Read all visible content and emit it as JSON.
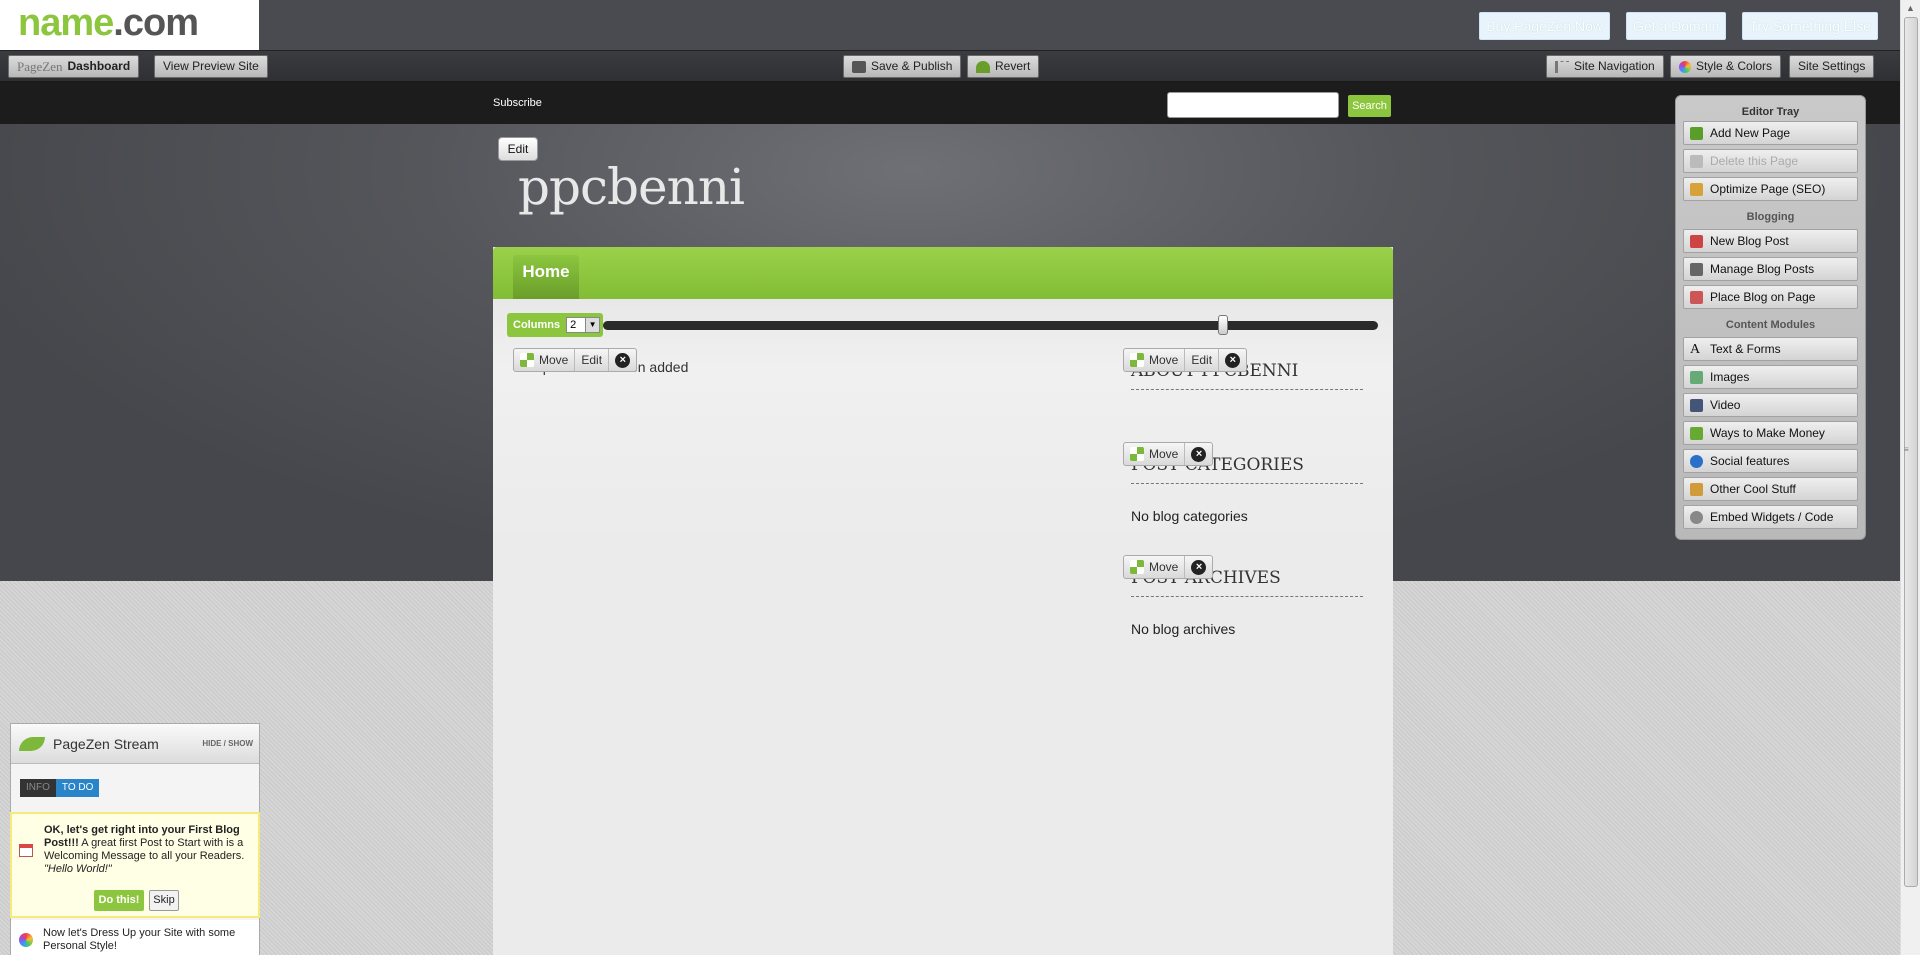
{
  "brand": {
    "logo_main": "name",
    "logo_dot": ".",
    "logo_com": "com"
  },
  "promo": [
    {
      "label": "Buy PageZen Now"
    },
    {
      "label": "Get a Domain"
    },
    {
      "label": "Try Something Else"
    }
  ],
  "toolbar": {
    "pagezen_logo": "PageZen",
    "dashboard": "Dashboard",
    "preview": "View Preview Site",
    "save_publish": "Save & Publish",
    "revert": "Revert",
    "site_navigation": "Site Navigation",
    "style_colors": "Style & Colors",
    "site_settings": "Site Settings"
  },
  "site_nav": {
    "subscribe": "Subscribe",
    "search_button": "Search",
    "search_placeholder": ""
  },
  "header": {
    "edit": "Edit",
    "site_title": "ppcbenni"
  },
  "menu": {
    "home": "Home"
  },
  "columns": {
    "label": "Columns",
    "value": "2",
    "slider_fraction": 0.8
  },
  "widget_controls": {
    "move": "Move",
    "edit": "Edit"
  },
  "main": {
    "empty_text": "No posts have been added"
  },
  "sidebar": [
    {
      "heading": "ABOUT PPCBENNI",
      "text": ""
    },
    {
      "heading": "POST CATEGORIES",
      "text": "No blog categories"
    },
    {
      "heading": "POST ARCHIVES",
      "text": "No blog archives"
    }
  ],
  "tray": {
    "title": "Editor Tray",
    "pages": [
      {
        "label": "Add New Page",
        "icon": "add-page-icon",
        "disabled": false
      },
      {
        "label": "Delete this Page",
        "icon": "delete-page-icon",
        "disabled": true
      },
      {
        "label": "Optimize Page (SEO)",
        "icon": "seo-icon",
        "disabled": false
      }
    ],
    "blogging_title": "Blogging",
    "blogging": [
      {
        "label": "New Blog Post",
        "icon": "new-post-icon"
      },
      {
        "label": "Manage Blog Posts",
        "icon": "calendar-icon"
      },
      {
        "label": "Place Blog on Page",
        "icon": "place-blog-icon"
      }
    ],
    "modules_title": "Content Modules",
    "modules": [
      {
        "label": "Text & Forms",
        "icon": "text-icon"
      },
      {
        "label": "Images",
        "icon": "image-icon"
      },
      {
        "label": "Video",
        "icon": "video-icon"
      },
      {
        "label": "Ways to Make Money",
        "icon": "dollar-icon"
      },
      {
        "label": "Social features",
        "icon": "speech-bubble-icon"
      },
      {
        "label": "Other Cool Stuff",
        "icon": "thumbs-up-icon"
      },
      {
        "label": "Embed Widgets / Code",
        "icon": "gear-icon"
      }
    ]
  },
  "stream": {
    "title": "PageZen Stream",
    "hide_show": "HIDE / SHOW",
    "tab_info": "INFO",
    "tab_todo": "TO DO",
    "todo_bold": "OK, let's get right into your First Blog Post!!!",
    "todo_text": " A great first Post to Start with is a Welcoming Message to all your Readers. ",
    "todo_italic": "\"Hello World!\"",
    "do_this": "Do this!",
    "skip": "Skip",
    "next_text": "Now let's Dress Up your Site with some Personal Style!"
  },
  "colors": {
    "accent_green": "#8cc63f",
    "todo_blue": "#2a85c8"
  }
}
